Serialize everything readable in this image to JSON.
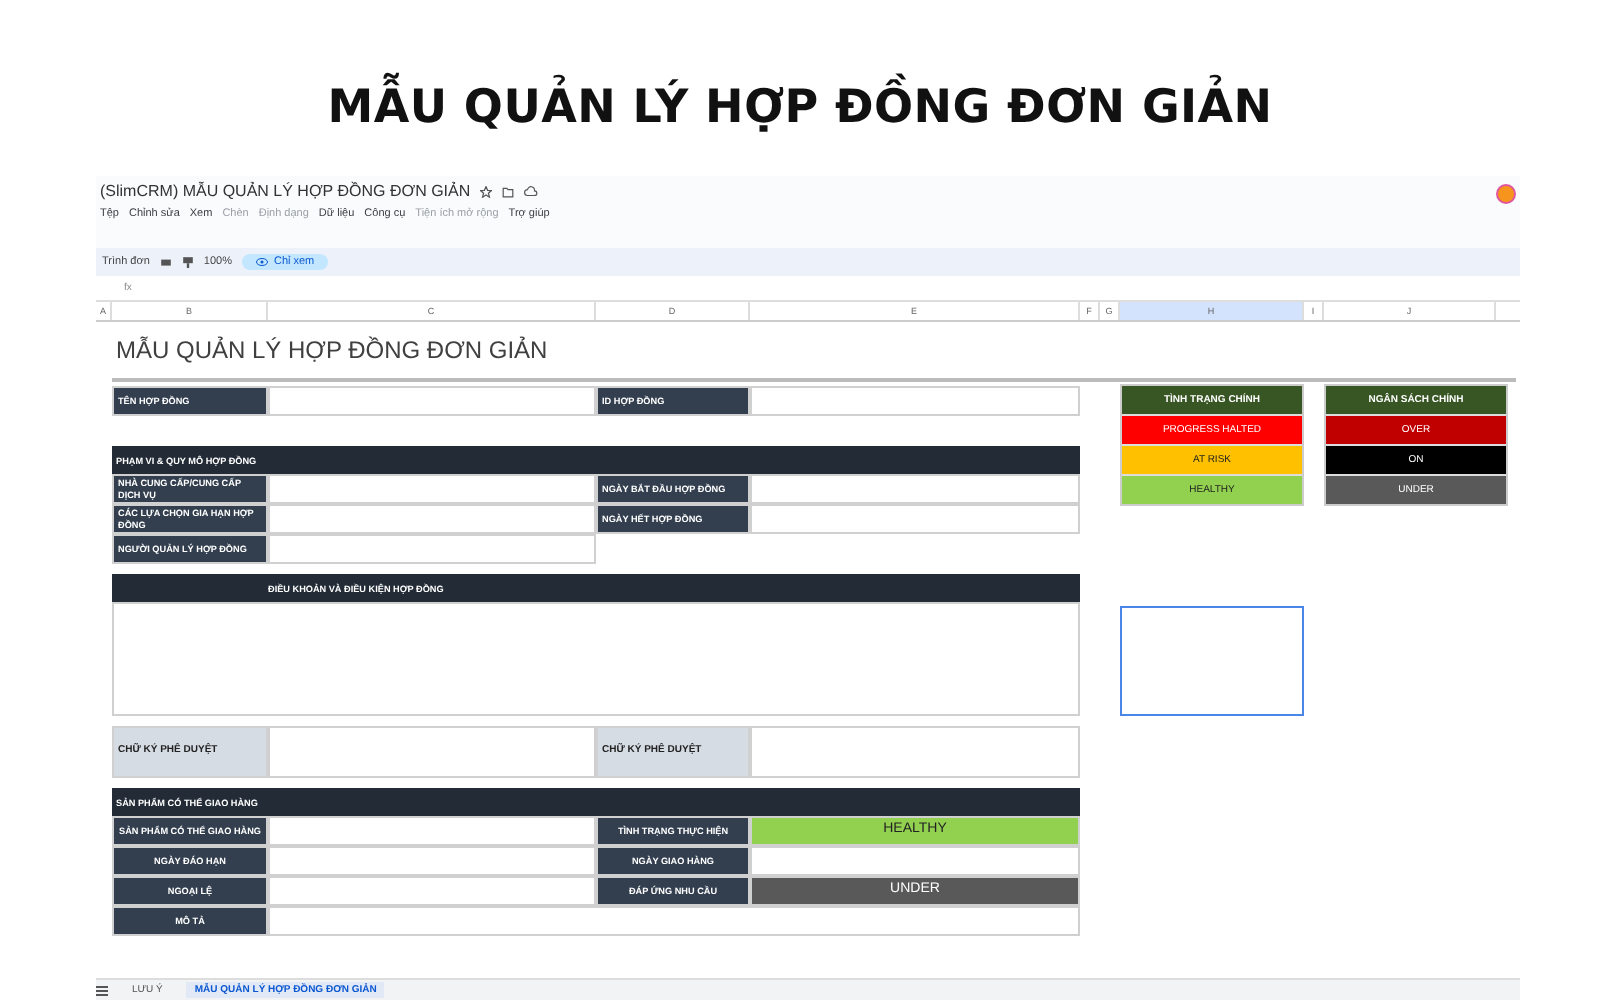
{
  "page_title": "MẪU QUẢN LÝ HỢP ĐỒNG ĐƠN GIẢN",
  "doc_title": "(SlimCRM) MẪU QUẢN LÝ HỢP ĐỒNG ĐƠN GIẢN",
  "menu": [
    {
      "label": "Tệp",
      "disabled": false
    },
    {
      "label": "Chỉnh sửa",
      "disabled": false
    },
    {
      "label": "Xem",
      "disabled": false
    },
    {
      "label": "Chèn",
      "disabled": true
    },
    {
      "label": "Định dạng",
      "disabled": true
    },
    {
      "label": "Dữ liệu",
      "disabled": false
    },
    {
      "label": "Công cụ",
      "disabled": false
    },
    {
      "label": "Tiện ích mở rộng",
      "disabled": true
    },
    {
      "label": "Trợ giúp",
      "disabled": false
    }
  ],
  "toolbar": {
    "menus": "Trình đơn",
    "zoom": "100%",
    "mode": "Chỉ xem"
  },
  "formula_bar": {
    "fx": "fx"
  },
  "columns": [
    {
      "label": "A",
      "selected": false
    },
    {
      "label": "B",
      "selected": false
    },
    {
      "label": "C",
      "selected": false
    },
    {
      "label": "D",
      "selected": false
    },
    {
      "label": "E",
      "selected": false
    },
    {
      "label": "F",
      "selected": false
    },
    {
      "label": "G",
      "selected": false
    },
    {
      "label": "H",
      "selected": true
    },
    {
      "label": "I",
      "selected": false
    },
    {
      "label": "J",
      "selected": false
    }
  ],
  "form": {
    "title": "MẪU QUẢN LÝ HỢP ĐỒNG ĐƠN GIẢN",
    "sections": [
      {
        "rows": [
          {
            "cells": [
              {
                "kind": "label",
                "text": "TÊN HỢP ĐỒNG"
              },
              {
                "kind": "blank"
              },
              {
                "kind": "label",
                "text": "ID HỢP ĐỒNG"
              },
              {
                "kind": "blank"
              }
            ]
          }
        ]
      },
      {
        "header": "PHẠM VI & QUY MÔ HỢP ĐỒNG",
        "rows": [
          {
            "cells": [
              {
                "kind": "label",
                "text": "NHÀ CUNG CẤP/CUNG CẤP DỊCH VỤ"
              },
              {
                "kind": "blank"
              },
              {
                "kind": "label",
                "text": "NGÀY BẮT ĐẦU HỢP ĐỒNG"
              },
              {
                "kind": "blank"
              }
            ]
          },
          {
            "cells": [
              {
                "kind": "label",
                "text": "CÁC LỰA CHỌN GIA HẠN HỢP ĐỒNG"
              },
              {
                "kind": "blank"
              },
              {
                "kind": "label",
                "text": "NGÀY HẾT HỢP ĐỒNG"
              },
              {
                "kind": "blank"
              }
            ]
          },
          {
            "cells": [
              {
                "kind": "label",
                "text": "NGƯỜI QUẢN LÝ HỢP ĐỒNG"
              },
              {
                "kind": "blank"
              }
            ]
          }
        ]
      },
      {
        "header": "ĐIỀU KHOẢN VÀ ĐIỀU KIỆN HỢP ĐỒNG",
        "kind": "text-box"
      },
      {
        "rows": [
          {
            "cells": [
              {
                "kind": "light",
                "text": "CHỮ KÝ PHÊ DUYỆT"
              },
              {
                "kind": "blank"
              },
              {
                "kind": "light",
                "text": "CHỮ KÝ PHÊ DUYỆT"
              },
              {
                "kind": "blank"
              }
            ]
          }
        ]
      },
      {
        "header": "SẢN PHẨM CÓ THỂ GIAO HÀNG",
        "rows": [
          {
            "cells": [
              {
                "kind": "center",
                "text": "SẢN PHẨM CÓ THỂ GIAO HÀNG"
              },
              {
                "kind": "blank"
              },
              {
                "kind": "center",
                "text": "TÌNH TRẠNG THỰC HIỆN"
              },
              {
                "kind": "status",
                "text": "HEALTHY",
                "color": "#92d050"
              }
            ]
          },
          {
            "cells": [
              {
                "kind": "center",
                "text": "NGÀY ĐÁO HẠN"
              },
              {
                "kind": "blank"
              },
              {
                "kind": "center",
                "text": "NGÀY GIAO HÀNG"
              },
              {
                "kind": "blank"
              }
            ]
          },
          {
            "cells": [
              {
                "kind": "center",
                "text": "NGOẠI LỆ"
              },
              {
                "kind": "blank"
              },
              {
                "kind": "center",
                "text": "ĐÁP ỨNG NHU CẦU"
              },
              {
                "kind": "status",
                "text": "UNDER",
                "color": "#595959"
              }
            ]
          },
          {
            "cells": [
              {
                "kind": "center",
                "text": "MÔ TẢ"
              },
              {
                "kind": "wide"
              }
            ]
          }
        ]
      }
    ]
  },
  "legends": [
    {
      "title": "TÌNH TRẠNG CHÍNH",
      "items": [
        {
          "text": "PROGRESS HALTED",
          "color": "#ff0000"
        },
        {
          "text": "AT RISK",
          "color": "#ffc000"
        },
        {
          "text": "HEALTHY",
          "color": "#92d050"
        }
      ]
    },
    {
      "title": "NGÂN SÁCH CHÍNH",
      "items": [
        {
          "text": "OVER",
          "color": "#c00000"
        },
        {
          "text": "ON",
          "color": "#000000"
        },
        {
          "text": "UNDER",
          "color": "#595959"
        }
      ]
    }
  ],
  "sheet_tabs": [
    {
      "label": "LƯU Ý",
      "selected": false
    },
    {
      "label": "MẪU QUẢN LÝ HỢP ĐỒNG ĐƠN GIẢN",
      "selected": true
    }
  ]
}
